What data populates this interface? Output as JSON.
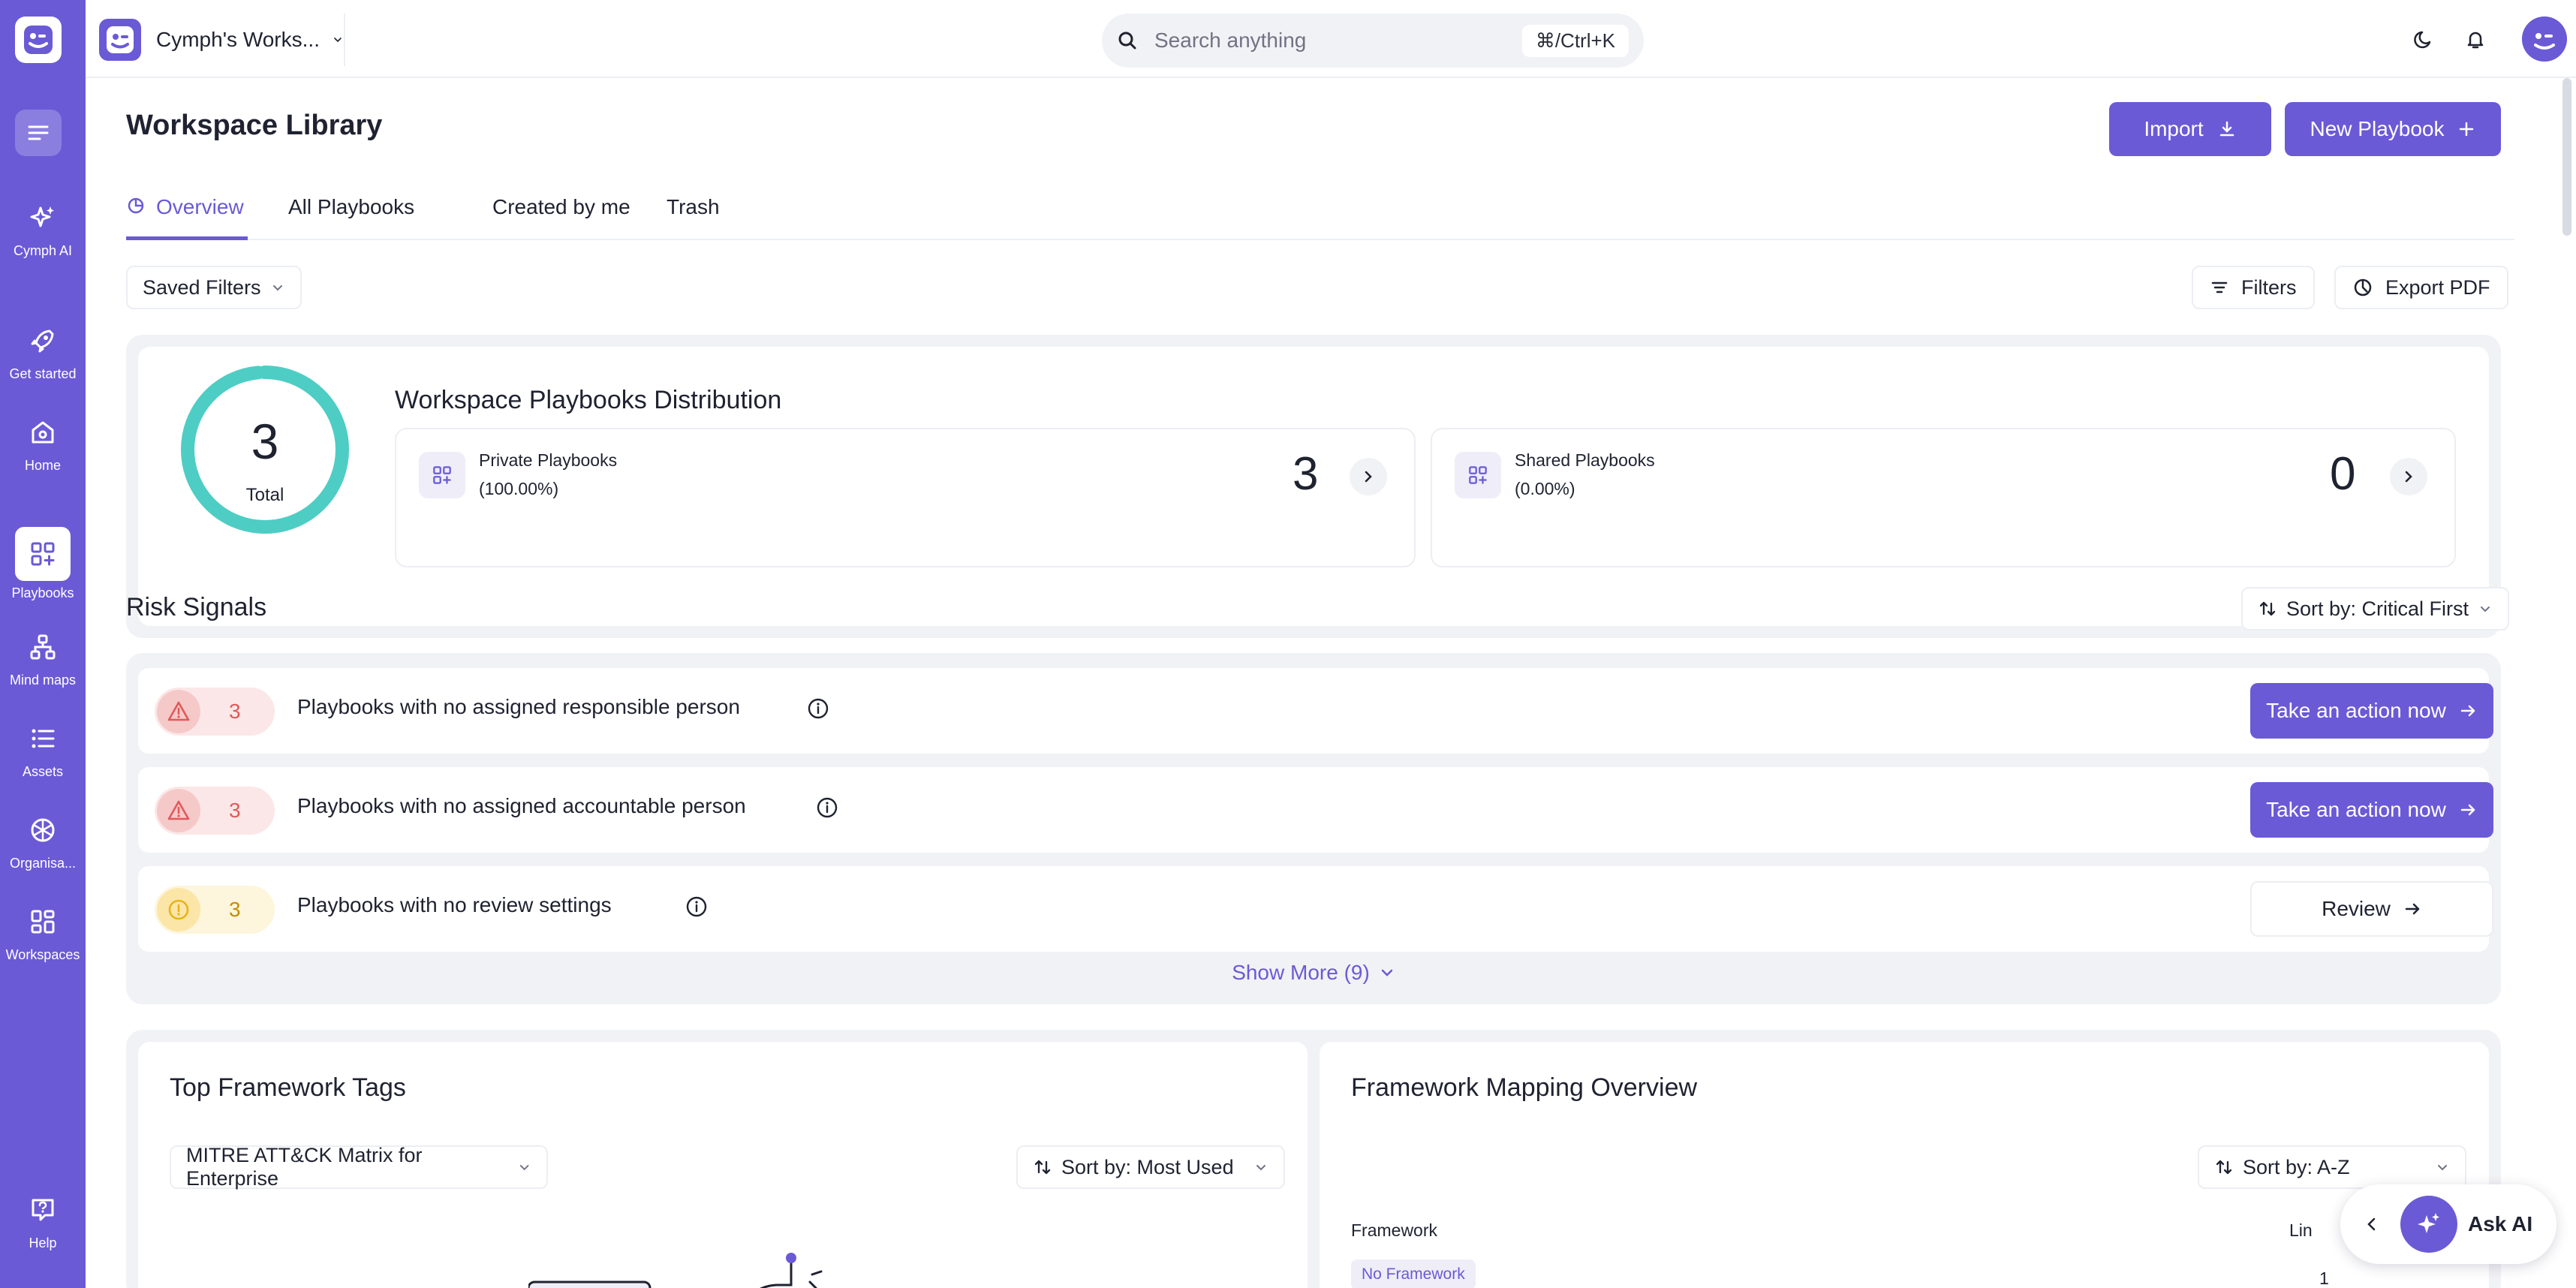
{
  "colors": {
    "accent": "#6a5ad6",
    "teal": "#4ecdc4",
    "danger": "#e05a5a",
    "warning": "#e8b31a"
  },
  "sidebar": {
    "items": [
      {
        "label": "Cymph AI",
        "icon": "sparkle-icon"
      },
      {
        "label": "Get started",
        "icon": "rocket-icon"
      },
      {
        "label": "Home",
        "icon": "home-icon"
      },
      {
        "label": "Playbooks",
        "icon": "playbooks-icon"
      },
      {
        "label": "Mind maps",
        "icon": "mindmap-icon"
      },
      {
        "label": "Assets",
        "icon": "list-icon"
      },
      {
        "label": "Organisa...",
        "icon": "cube-icon"
      },
      {
        "label": "Workspaces",
        "icon": "grid-icon"
      },
      {
        "label": "Help",
        "icon": "help-icon"
      }
    ]
  },
  "topbar": {
    "workspace_name": "Cymph's Works...",
    "search_placeholder": "Search anything",
    "search_shortcut": "⌘/Ctrl+K"
  },
  "page": {
    "title": "Workspace Library",
    "import_label": "Import",
    "new_playbook_label": "New Playbook",
    "tabs": [
      "Overview",
      "All Playbooks",
      "Created by me",
      "Trash"
    ],
    "active_tab": "Overview",
    "saved_filters_label": "Saved Filters",
    "filters_label": "Filters",
    "export_pdf_label": "Export PDF"
  },
  "distribution": {
    "title": "Workspace Playbooks Distribution",
    "total": "3",
    "total_label": "Total",
    "private_fraction": 1.0,
    "private": {
      "name": "Private Playbooks",
      "pct": "(100.00%)",
      "value": "3"
    },
    "shared": {
      "name": "Shared Playbooks",
      "pct": "(0.00%)",
      "value": "0"
    }
  },
  "risk": {
    "title": "Risk Signals",
    "sort_label": "Sort by: Critical First",
    "rows": [
      {
        "count": "3",
        "text": "Playbooks with no assigned responsible person",
        "action": "Take an action now",
        "severity": "critical"
      },
      {
        "count": "3",
        "text": "Playbooks with no assigned accountable person",
        "action": "Take an action now",
        "severity": "critical"
      },
      {
        "count": "3",
        "text": "Playbooks with no review settings",
        "action": "Review",
        "severity": "warning"
      }
    ],
    "show_more": "Show More (9)"
  },
  "framework_tags": {
    "title": "Top Framework Tags",
    "framework_select": "MITRE ATT&CK Matrix for Enterprise",
    "sort_label": "Sort by: Most Used"
  },
  "framework_mapping": {
    "title": "Framework Mapping Overview",
    "sort_label": "Sort by: A-Z",
    "column_framework": "Framework",
    "column_linked": "Lin",
    "row_tag": "No Framework",
    "row_count": "1"
  },
  "ask_ai_label": "Ask AI"
}
